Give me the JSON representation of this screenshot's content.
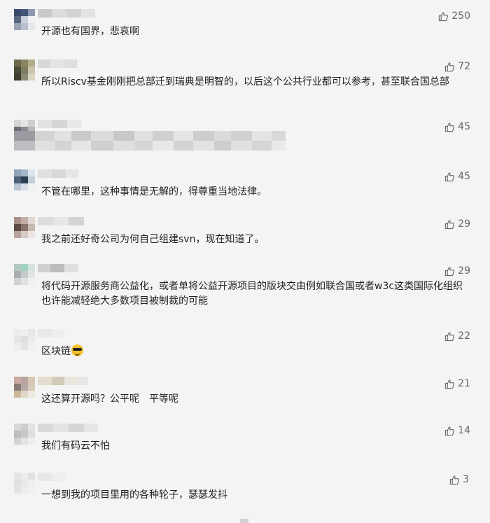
{
  "comments": [
    {
      "id": "c1",
      "likes": "250",
      "text": "开源也有国界，悲哀啊"
    },
    {
      "id": "c2",
      "likes": "72",
      "text": "所以Riscv基金刚刚把总部迁到瑞典是明智的，以后这个公共行业都可以参考，甚至联合国总部"
    },
    {
      "id": "c3",
      "likes": "45",
      "text": ""
    },
    {
      "id": "c4",
      "likes": "45",
      "text": "不管在哪里，这种事情是无解的，得尊重当地法律。"
    },
    {
      "id": "c5",
      "likes": "29",
      "text": "我之前还好奇公司为何自己组建svn，现在知道了。"
    },
    {
      "id": "c6",
      "likes": "29",
      "text": "将代码开源服务商公益化，或者单将公益开源项目的版块交由例如联合国或者w3c这类国际化组织也许能减轻绝大多数项目被制裁的可能"
    },
    {
      "id": "c7",
      "likes": "22",
      "text": "区块链",
      "emoji": "sunglasses-emoji"
    },
    {
      "id": "c8",
      "likes": "21",
      "text": "这还算开源吗？公平呢　平等呢"
    },
    {
      "id": "c9",
      "likes": "14",
      "text": "我们有码云不怕"
    },
    {
      "id": "c10",
      "likes": "3",
      "text": "一想到我的项目里用的各种轮子，瑟瑟发抖"
    }
  ],
  "icons": {
    "like": "thumbs-up-icon"
  },
  "colors": {
    "background": "#f4f4f4",
    "text": "#222222",
    "muted": "#666666"
  }
}
